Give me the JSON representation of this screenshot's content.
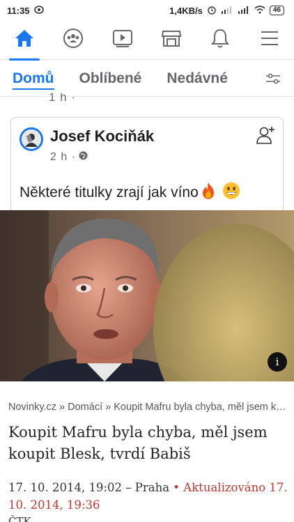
{
  "status_bar": {
    "time": "11:35",
    "network_speed": "1,4KB/s",
    "battery": "46"
  },
  "nav": {
    "icons": [
      "home-icon",
      "groups-icon",
      "watch-icon",
      "marketplace-icon",
      "notifications-icon",
      "menu-icon"
    ],
    "active": "home-icon",
    "accent_color": "#1877f2"
  },
  "tabs": {
    "items": [
      "Domů",
      "Oblíbené",
      "Nedávné"
    ],
    "active": "Domů"
  },
  "previous_post": {
    "meta": "1 h · "
  },
  "post": {
    "author": "Josef Kociňák",
    "time": "2 h · ",
    "text": "Některé titulky zrají jak víno",
    "emojis": [
      "fire-emoji",
      "grinning-face-emoji"
    ]
  },
  "article": {
    "breadcrumb": "Novinky.cz » Domácí » Koupit Mafru byla chyba, měl jsem ko...",
    "headline": "Koupit Mafru byla chyba, měl jsem koupit Blesk, tvrdí Babiš",
    "date": "17. 10. 2014, 19:02 – Praha",
    "bullet": " • ",
    "updated": "Aktualizováno 17. 10. 2014, 19:36",
    "source": "ČTK"
  }
}
